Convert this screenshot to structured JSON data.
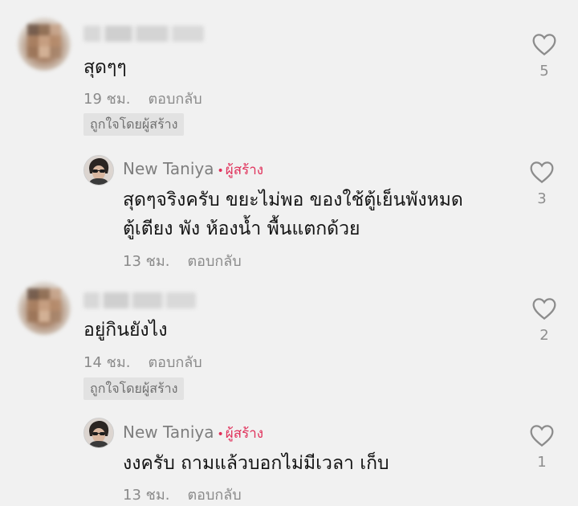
{
  "comments": [
    {
      "text": "สุดๆๆ",
      "time": "19 ชม.",
      "reply_label": "ตอบกลับ",
      "badge": "ถูกใจโดยผู้สร้าง",
      "likes": "5"
    },
    {
      "author": "New Taniya",
      "creator_tag": "ผู้สร้าง",
      "text_lines": [
        "สุดๆจริงครับ ขยะไม่พอ ของใช้ตู้เย็นพังหมด",
        "ตู้เตียง พัง ห้องน้ำ พื้นแตกด้วย"
      ],
      "time": "13 ชม.",
      "reply_label": "ตอบกลับ",
      "likes": "3"
    },
    {
      "text": "อยู่กินยังไง",
      "time": "14 ชม.",
      "reply_label": "ตอบกลับ",
      "badge": "ถูกใจโดยผู้สร้าง",
      "likes": "2"
    },
    {
      "author": "New Taniya",
      "creator_tag": "ผู้สร้าง",
      "text": "งงครับ ถามแล้วบอกไม่มีเวลา เก็บ",
      "time": "13 ชม.",
      "reply_label": "ตอบกลับ",
      "likes": "1"
    }
  ],
  "icons": {
    "like": "heart-outline-icon",
    "dot": "bullet"
  },
  "colors": {
    "creator_tag": "#e0305a",
    "background": "#f1f1f1",
    "meta": "#8a8a8a"
  }
}
